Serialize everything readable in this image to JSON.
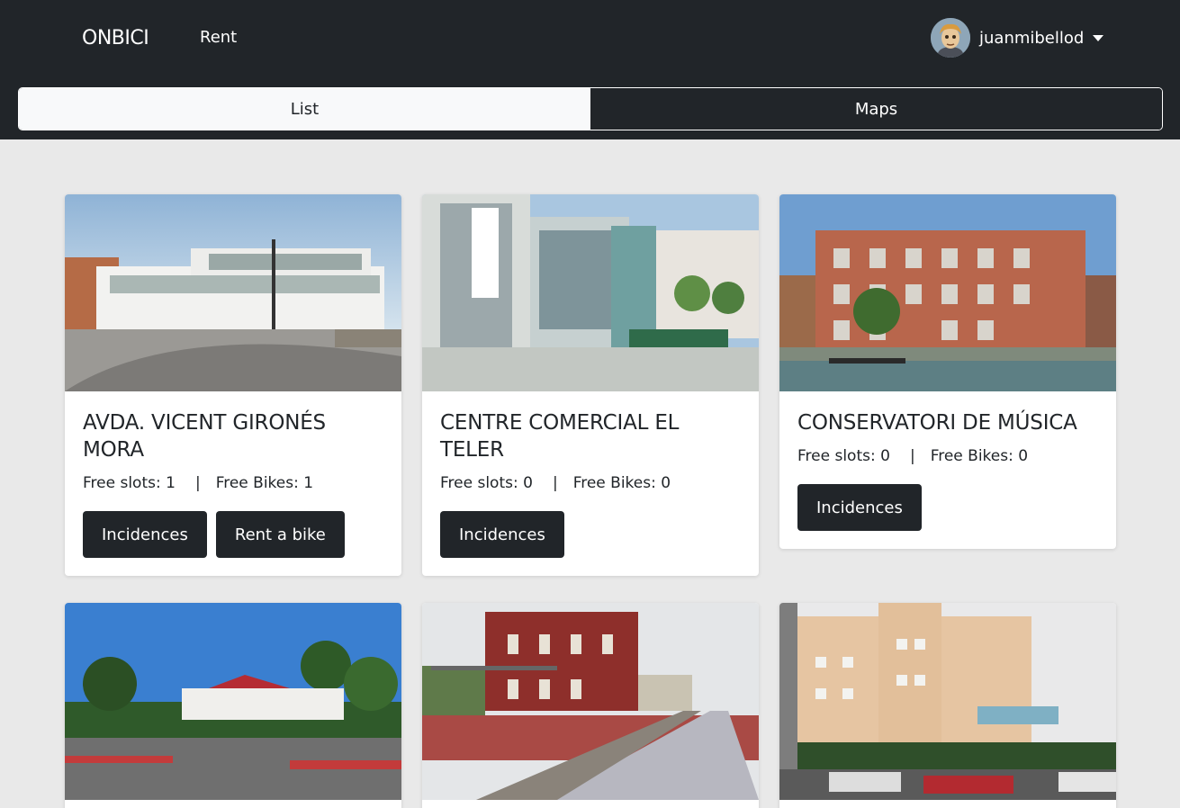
{
  "navbar": {
    "brand": "ONBICI",
    "rent_link": "Rent",
    "user": {
      "name": "juanmibellod",
      "avatar_icon": "user-avatar"
    }
  },
  "tabs": [
    {
      "label": "List",
      "active": true
    },
    {
      "label": "Maps",
      "active": false
    }
  ],
  "labels": {
    "free_slots": "Free slots:",
    "free_bikes": "Free Bikes:",
    "separator": "|"
  },
  "stations": [
    {
      "name": "AVDA. VICENT GIRONÉS MORA",
      "free_slots": "1",
      "free_bikes": "1",
      "buttons": [
        "Incidences",
        "Rent a bike"
      ],
      "image": "modern white building"
    },
    {
      "name": "CENTRE COMERCIAL EL TELER",
      "free_slots": "0",
      "free_bikes": "0",
      "buttons": [
        "Incidences"
      ],
      "image": "shopping centre"
    },
    {
      "name": "CONSERVATORI DE MÚSICA",
      "free_slots": "0",
      "free_bikes": "0",
      "buttons": [
        "Incidences"
      ],
      "image": "brick music school"
    },
    {
      "name": "",
      "image": "pavilion with trees"
    },
    {
      "name": "",
      "image": "train station"
    },
    {
      "name": "",
      "image": "hospital building"
    }
  ],
  "colors": {
    "dark": "#212529",
    "light": "#f8f9fa",
    "background": "#e9e9e9"
  }
}
